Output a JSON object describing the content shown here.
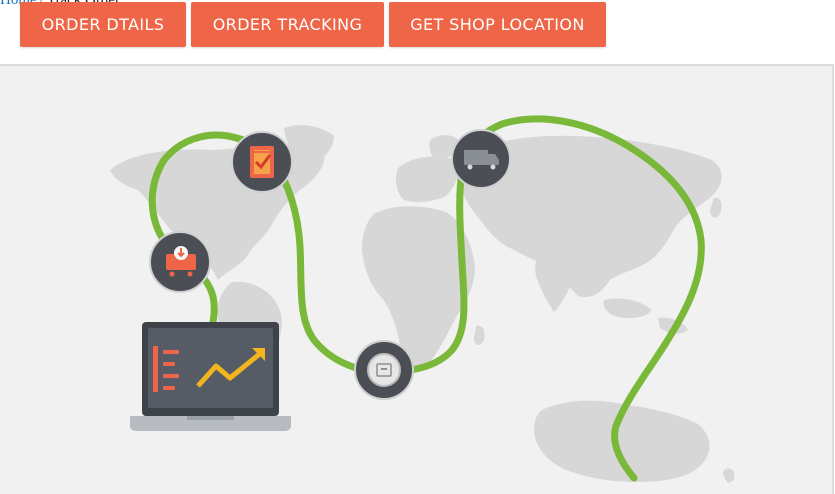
{
  "breadcrumb": {
    "home_label": "Home",
    "separator": "/",
    "current_label": "Track Order"
  },
  "tabs": [
    {
      "label": "ORDER DTAILS"
    },
    {
      "label": "ORDER TRACKING"
    },
    {
      "label": "GET SHOP LOCATION"
    }
  ],
  "tracking_illustration": {
    "stages": [
      {
        "icon": "order-placed-icon"
      },
      {
        "icon": "order-confirmed-icon"
      },
      {
        "icon": "package-icon"
      },
      {
        "icon": "delivery-truck-icon"
      }
    ],
    "laptop_icon": "analytics-laptop-icon"
  },
  "colors": {
    "tab_background": "#ee6547",
    "tab_text": "#ffffff",
    "route_line": "#7ab83a",
    "map_land": "#d7d7d7",
    "panel_background": "#f1f1f1",
    "stage_circle": "#4b4f55",
    "link": "#1f72b8"
  }
}
